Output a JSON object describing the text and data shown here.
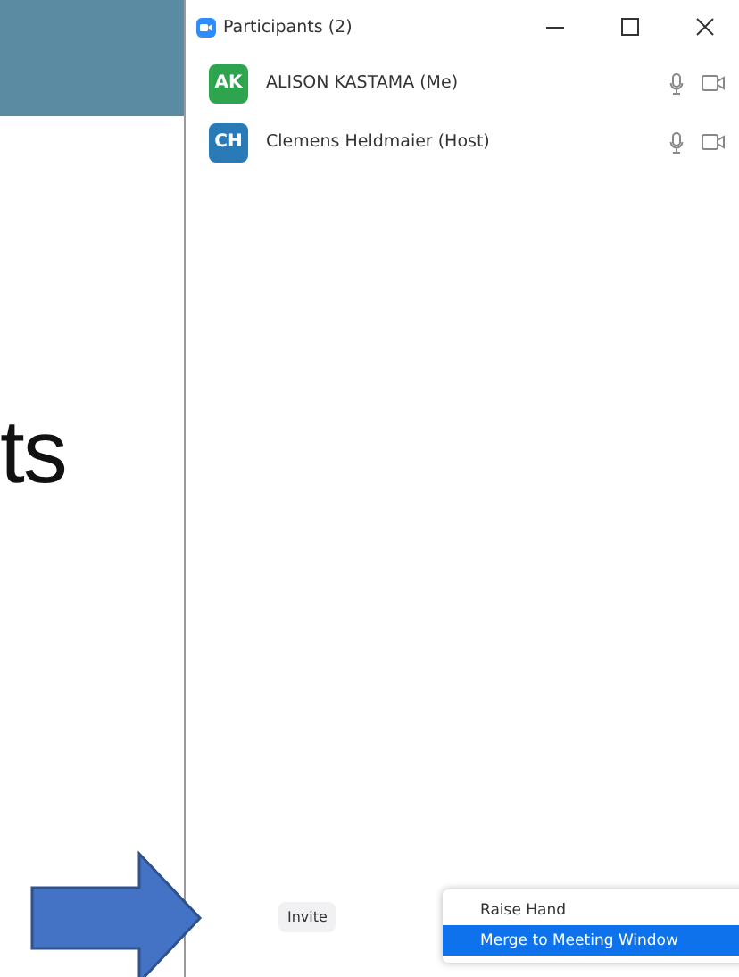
{
  "slide": {
    "text": "ts"
  },
  "window": {
    "title": "Participants (2)"
  },
  "participants": [
    {
      "initials": "AK",
      "name": "ALISON KASTAMA (Me)",
      "color": "#2ea44f"
    },
    {
      "initials": "CH",
      "name": "Clemens Heldmaier (Host)",
      "color": "#2a7ab8"
    }
  ],
  "footer": {
    "invite": "Invite"
  },
  "menu": [
    {
      "label": "Raise Hand",
      "selected": false
    },
    {
      "label": "Merge to Meeting Window",
      "selected": true
    }
  ]
}
